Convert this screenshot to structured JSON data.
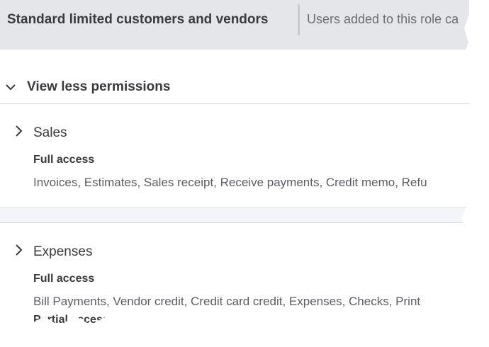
{
  "header": {
    "role_name": "Standard limited customers and vendors",
    "role_description": "Users added to this role ca"
  },
  "permissions_toggle": {
    "label": "View less permissions",
    "icon": "chevron-down-icon"
  },
  "sections": [
    {
      "title": "Sales",
      "expand_icon": "chevron-right-icon",
      "access_level": "Full access",
      "items": "Invoices, Estimates, Sales receipt, Receive payments, Credit memo, Refu"
    },
    {
      "title": "Expenses",
      "expand_icon": "chevron-right-icon",
      "access_level": "Full access",
      "items": "Bill Payments, Vendor credit, Credit card credit, Expenses, Checks, Print",
      "next_access_level": "Partial access"
    }
  ],
  "colors": {
    "header_background": "#e4e6e9",
    "text_primary": "#393a3d",
    "text_secondary": "#5c5d62",
    "divider": "#d4d7dc"
  }
}
